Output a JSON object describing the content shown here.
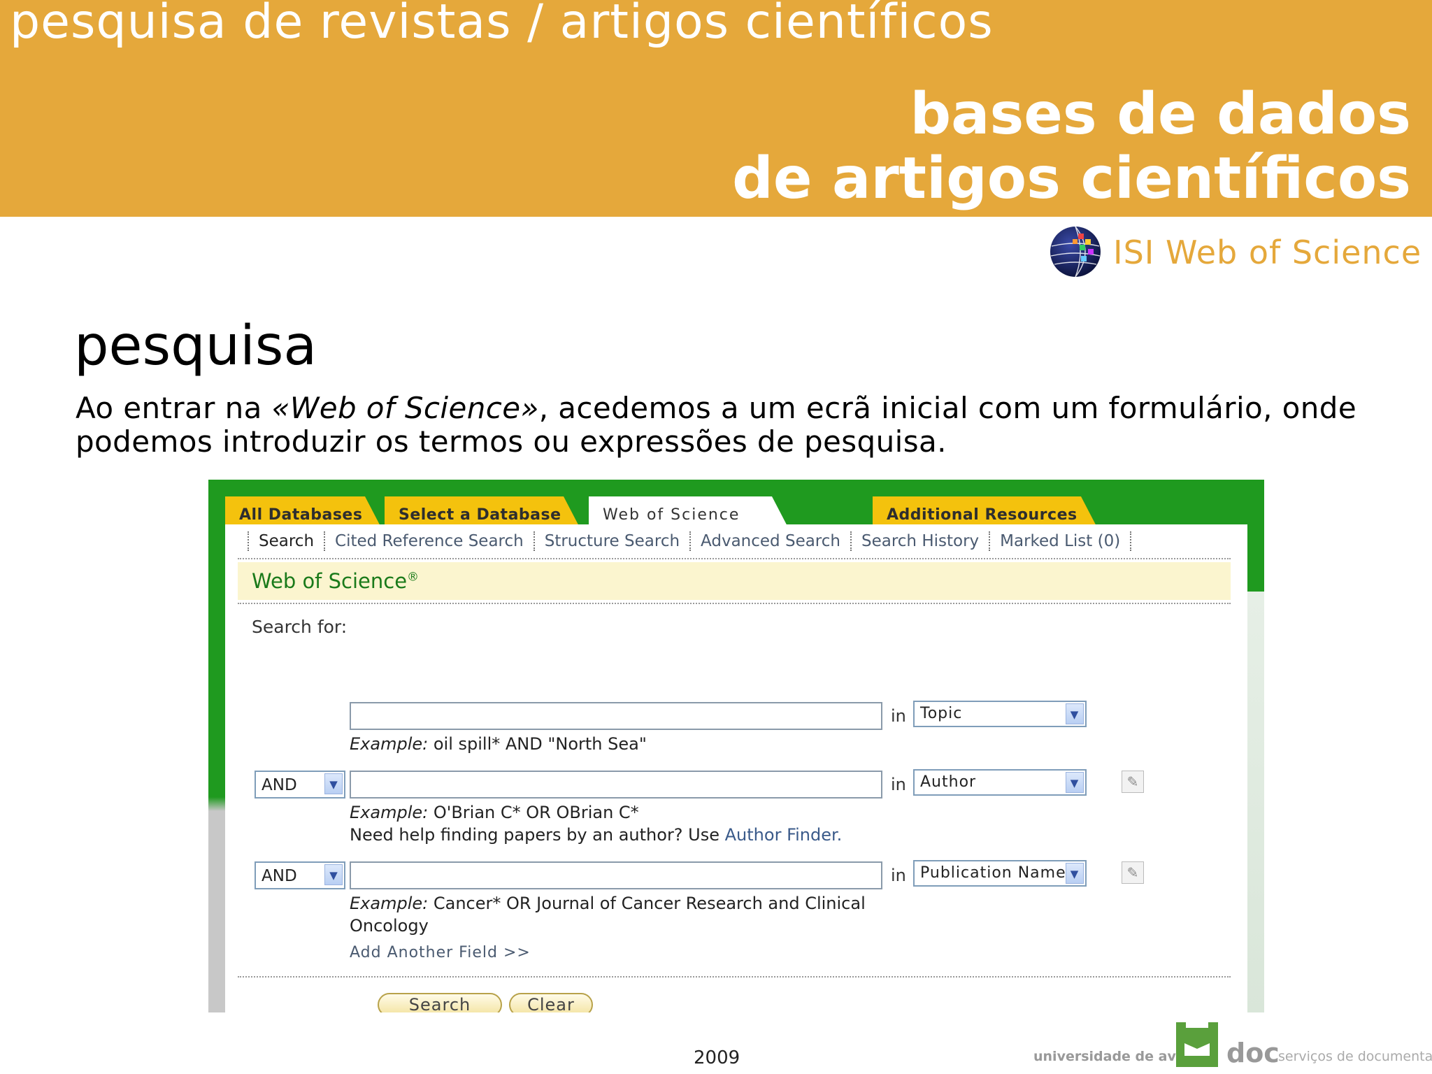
{
  "header": {
    "section_title": "pesquisa de revistas / artigos científicos",
    "main_title_line1": "bases de dados",
    "main_title_line2": "de artigos científicos",
    "logo_label": "ISI Web of Science"
  },
  "slide": {
    "heading": "pesquisa",
    "body_before": "Ao entrar na ",
    "body_emph": "«Web of Science»",
    "body_after": ", acedemos a um ecrã inicial com um formulário, onde podemos introduzir os termos ou expressões de pesquisa."
  },
  "screenshot": {
    "tabs": [
      "All Databases",
      "Select a Database",
      "Web of Science",
      "Additional Resources"
    ],
    "active_tab": "Web of Science",
    "subnav": [
      "Search",
      "Cited Reference Search",
      "Structure Search",
      "Advanced Search",
      "Search History",
      "Marked List (0)"
    ],
    "panel_title": "Web of Science",
    "panel_title_mark": "®",
    "search_for_label": "Search for:",
    "in_label": "in",
    "rows": [
      {
        "operator": "",
        "field": "Topic",
        "example_label": "Example:",
        "example_text": " oil spill* AND \"North Sea\"",
        "help_text": "",
        "help_link": ""
      },
      {
        "operator": "AND",
        "field": "Author",
        "example_label": "Example:",
        "example_text": " O'Brian C* OR OBrian C*",
        "help_text": "Need help finding papers by an author? Use ",
        "help_link": "Author Finder."
      },
      {
        "operator": "AND",
        "field": "Publication Name",
        "example_label": "Example:",
        "example_text": " Cancer* OR Journal of Cancer Research and Clinical Oncology",
        "help_text": "",
        "help_link": ""
      }
    ],
    "add_field_link": "Add Another Field >>",
    "search_button": "Search",
    "clear_button": "Clear"
  },
  "footer": {
    "year": "2009",
    "university": "universidade de aveiro",
    "doc": "doc",
    "services": "serviços de documentação"
  },
  "colors": {
    "banner": "#e5a83b",
    "frame_green": "#1f9a1f",
    "tab_yellow": "#f4c20d",
    "panel_title_bg": "#fbf5cf",
    "logo_green": "#5aa03c"
  },
  "icons": [
    "globe-icon",
    "chevron-down-icon",
    "lookup-icon",
    "ua-logo-icon"
  ]
}
